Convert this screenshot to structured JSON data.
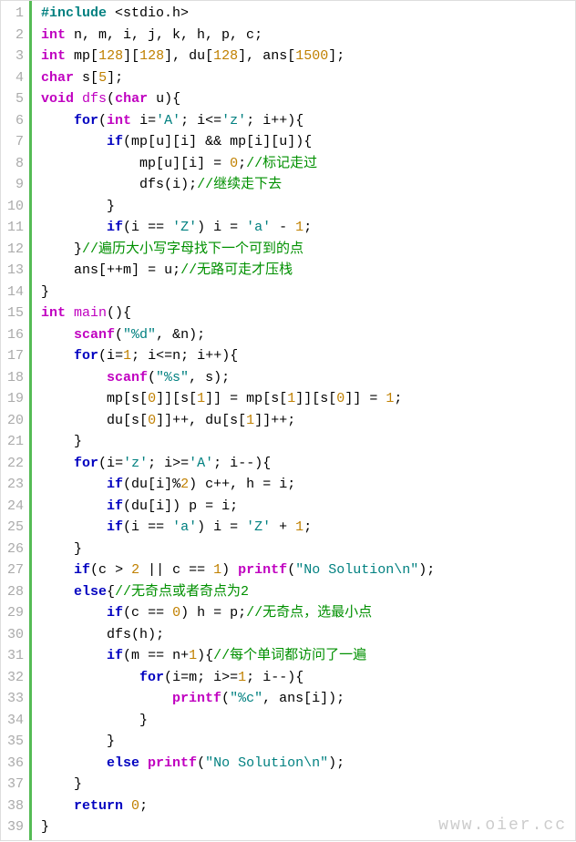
{
  "watermark": "www.oier.cc",
  "line_count": 39,
  "code_lines": [
    [
      [
        "pp",
        "#include"
      ],
      [
        "op",
        " <"
      ],
      [
        "id",
        "stdio.h"
      ],
      [
        "op",
        ">"
      ]
    ],
    [
      [
        "ty",
        "int"
      ],
      [
        "op",
        " "
      ],
      [
        "id",
        "n, m, i, j, k, h, p, c"
      ],
      [
        "op",
        ";"
      ]
    ],
    [
      [
        "ty",
        "int"
      ],
      [
        "op",
        " "
      ],
      [
        "id",
        "mp"
      ],
      [
        "op",
        "["
      ],
      [
        "num",
        "128"
      ],
      [
        "op",
        "]["
      ],
      [
        "num",
        "128"
      ],
      [
        "op",
        "], "
      ],
      [
        "id",
        "du"
      ],
      [
        "op",
        "["
      ],
      [
        "num",
        "128"
      ],
      [
        "op",
        "], "
      ],
      [
        "id",
        "ans"
      ],
      [
        "op",
        "["
      ],
      [
        "num",
        "1500"
      ],
      [
        "op",
        "];"
      ]
    ],
    [
      [
        "ty",
        "char"
      ],
      [
        "op",
        " "
      ],
      [
        "id",
        "s"
      ],
      [
        "op",
        "["
      ],
      [
        "num",
        "5"
      ],
      [
        "op",
        "];"
      ]
    ],
    [
      [
        "ty",
        "void"
      ],
      [
        "op",
        " "
      ],
      [
        "fn",
        "dfs"
      ],
      [
        "op",
        "("
      ],
      [
        "ty",
        "char"
      ],
      [
        "op",
        " "
      ],
      [
        "id",
        "u"
      ],
      [
        "op",
        "){"
      ]
    ],
    [
      [
        "op",
        "    "
      ],
      [
        "kw",
        "for"
      ],
      [
        "op",
        "("
      ],
      [
        "ty",
        "int"
      ],
      [
        "op",
        " "
      ],
      [
        "id",
        "i"
      ],
      [
        "op",
        "="
      ],
      [
        "chr",
        "'A'"
      ],
      [
        "op",
        "; "
      ],
      [
        "id",
        "i"
      ],
      [
        "op",
        "<="
      ],
      [
        "chr",
        "'z'"
      ],
      [
        "op",
        "; "
      ],
      [
        "id",
        "i"
      ],
      [
        "op",
        "++){"
      ]
    ],
    [
      [
        "op",
        "        "
      ],
      [
        "kw",
        "if"
      ],
      [
        "op",
        "("
      ],
      [
        "id",
        "mp"
      ],
      [
        "op",
        "["
      ],
      [
        "id",
        "u"
      ],
      [
        "op",
        "]["
      ],
      [
        "id",
        "i"
      ],
      [
        "op",
        "] && "
      ],
      [
        "id",
        "mp"
      ],
      [
        "op",
        "["
      ],
      [
        "id",
        "i"
      ],
      [
        "op",
        "]["
      ],
      [
        "id",
        "u"
      ],
      [
        "op",
        "]){"
      ]
    ],
    [
      [
        "op",
        "            "
      ],
      [
        "id",
        "mp"
      ],
      [
        "op",
        "["
      ],
      [
        "id",
        "u"
      ],
      [
        "op",
        "]["
      ],
      [
        "id",
        "i"
      ],
      [
        "op",
        "] = "
      ],
      [
        "num",
        "0"
      ],
      [
        "op",
        ";"
      ],
      [
        "cmt",
        "//标记走过"
      ]
    ],
    [
      [
        "op",
        "            "
      ],
      [
        "id",
        "dfs"
      ],
      [
        "op",
        "("
      ],
      [
        "id",
        "i"
      ],
      [
        "op",
        ");"
      ],
      [
        "cmt",
        "//继续走下去"
      ]
    ],
    [
      [
        "op",
        "        }"
      ]
    ],
    [
      [
        "op",
        "        "
      ],
      [
        "kw",
        "if"
      ],
      [
        "op",
        "("
      ],
      [
        "id",
        "i"
      ],
      [
        "op",
        " == "
      ],
      [
        "chr",
        "'Z'"
      ],
      [
        "op",
        ") "
      ],
      [
        "id",
        "i"
      ],
      [
        "op",
        " = "
      ],
      [
        "chr",
        "'a'"
      ],
      [
        "op",
        " - "
      ],
      [
        "num",
        "1"
      ],
      [
        "op",
        ";"
      ]
    ],
    [
      [
        "op",
        "    }"
      ],
      [
        "cmt",
        "//遍历大小写字母找下一个可到的点"
      ]
    ],
    [
      [
        "op",
        "    "
      ],
      [
        "id",
        "ans"
      ],
      [
        "op",
        "[++"
      ],
      [
        "id",
        "m"
      ],
      [
        "op",
        "] = "
      ],
      [
        "id",
        "u"
      ],
      [
        "op",
        ";"
      ],
      [
        "cmt",
        "//无路可走才压栈"
      ]
    ],
    [
      [
        "op",
        "}"
      ]
    ],
    [
      [
        "ty",
        "int"
      ],
      [
        "op",
        " "
      ],
      [
        "fn",
        "main"
      ],
      [
        "op",
        "(){"
      ]
    ],
    [
      [
        "op",
        "    "
      ],
      [
        "lib",
        "scanf"
      ],
      [
        "op",
        "("
      ],
      [
        "str",
        "\"%d\""
      ],
      [
        "op",
        ", &"
      ],
      [
        "id",
        "n"
      ],
      [
        "op",
        ");"
      ]
    ],
    [
      [
        "op",
        "    "
      ],
      [
        "kw",
        "for"
      ],
      [
        "op",
        "("
      ],
      [
        "id",
        "i"
      ],
      [
        "op",
        "="
      ],
      [
        "num",
        "1"
      ],
      [
        "op",
        "; "
      ],
      [
        "id",
        "i"
      ],
      [
        "op",
        "<="
      ],
      [
        "id",
        "n"
      ],
      [
        "op",
        "; "
      ],
      [
        "id",
        "i"
      ],
      [
        "op",
        "++){"
      ]
    ],
    [
      [
        "op",
        "        "
      ],
      [
        "lib",
        "scanf"
      ],
      [
        "op",
        "("
      ],
      [
        "str",
        "\"%s\""
      ],
      [
        "op",
        ", "
      ],
      [
        "id",
        "s"
      ],
      [
        "op",
        ");"
      ]
    ],
    [
      [
        "op",
        "        "
      ],
      [
        "id",
        "mp"
      ],
      [
        "op",
        "["
      ],
      [
        "id",
        "s"
      ],
      [
        "op",
        "["
      ],
      [
        "num",
        "0"
      ],
      [
        "op",
        "]]["
      ],
      [
        "id",
        "s"
      ],
      [
        "op",
        "["
      ],
      [
        "num",
        "1"
      ],
      [
        "op",
        "]] = "
      ],
      [
        "id",
        "mp"
      ],
      [
        "op",
        "["
      ],
      [
        "id",
        "s"
      ],
      [
        "op",
        "["
      ],
      [
        "num",
        "1"
      ],
      [
        "op",
        "]]["
      ],
      [
        "id",
        "s"
      ],
      [
        "op",
        "["
      ],
      [
        "num",
        "0"
      ],
      [
        "op",
        "]] = "
      ],
      [
        "num",
        "1"
      ],
      [
        "op",
        ";"
      ]
    ],
    [
      [
        "op",
        "        "
      ],
      [
        "id",
        "du"
      ],
      [
        "op",
        "["
      ],
      [
        "id",
        "s"
      ],
      [
        "op",
        "["
      ],
      [
        "num",
        "0"
      ],
      [
        "op",
        "]]++, "
      ],
      [
        "id",
        "du"
      ],
      [
        "op",
        "["
      ],
      [
        "id",
        "s"
      ],
      [
        "op",
        "["
      ],
      [
        "num",
        "1"
      ],
      [
        "op",
        "]]++;"
      ]
    ],
    [
      [
        "op",
        "    }"
      ]
    ],
    [
      [
        "op",
        "    "
      ],
      [
        "kw",
        "for"
      ],
      [
        "op",
        "("
      ],
      [
        "id",
        "i"
      ],
      [
        "op",
        "="
      ],
      [
        "chr",
        "'z'"
      ],
      [
        "op",
        "; "
      ],
      [
        "id",
        "i"
      ],
      [
        "op",
        ">="
      ],
      [
        "chr",
        "'A'"
      ],
      [
        "op",
        "; "
      ],
      [
        "id",
        "i"
      ],
      [
        "op",
        "--){"
      ]
    ],
    [
      [
        "op",
        "        "
      ],
      [
        "kw",
        "if"
      ],
      [
        "op",
        "("
      ],
      [
        "id",
        "du"
      ],
      [
        "op",
        "["
      ],
      [
        "id",
        "i"
      ],
      [
        "op",
        "]%"
      ],
      [
        "num",
        "2"
      ],
      [
        "op",
        ") "
      ],
      [
        "id",
        "c"
      ],
      [
        "op",
        "++, "
      ],
      [
        "id",
        "h"
      ],
      [
        "op",
        " = "
      ],
      [
        "id",
        "i"
      ],
      [
        "op",
        ";"
      ]
    ],
    [
      [
        "op",
        "        "
      ],
      [
        "kw",
        "if"
      ],
      [
        "op",
        "("
      ],
      [
        "id",
        "du"
      ],
      [
        "op",
        "["
      ],
      [
        "id",
        "i"
      ],
      [
        "op",
        "]) "
      ],
      [
        "id",
        "p"
      ],
      [
        "op",
        " = "
      ],
      [
        "id",
        "i"
      ],
      [
        "op",
        ";"
      ]
    ],
    [
      [
        "op",
        "        "
      ],
      [
        "kw",
        "if"
      ],
      [
        "op",
        "("
      ],
      [
        "id",
        "i"
      ],
      [
        "op",
        " == "
      ],
      [
        "chr",
        "'a'"
      ],
      [
        "op",
        ") "
      ],
      [
        "id",
        "i"
      ],
      [
        "op",
        " = "
      ],
      [
        "chr",
        "'Z'"
      ],
      [
        "op",
        " + "
      ],
      [
        "num",
        "1"
      ],
      [
        "op",
        ";"
      ]
    ],
    [
      [
        "op",
        "    }"
      ]
    ],
    [
      [
        "op",
        "    "
      ],
      [
        "kw",
        "if"
      ],
      [
        "op",
        "("
      ],
      [
        "id",
        "c"
      ],
      [
        "op",
        " > "
      ],
      [
        "num",
        "2"
      ],
      [
        "op",
        " || "
      ],
      [
        "id",
        "c"
      ],
      [
        "op",
        " == "
      ],
      [
        "num",
        "1"
      ],
      [
        "op",
        ") "
      ],
      [
        "lib",
        "printf"
      ],
      [
        "op",
        "("
      ],
      [
        "str",
        "\"No Solution\\n\""
      ],
      [
        "op",
        ");"
      ]
    ],
    [
      [
        "op",
        "    "
      ],
      [
        "kw",
        "else"
      ],
      [
        "op",
        "{"
      ],
      [
        "cmt",
        "//无奇点或者奇点为2"
      ]
    ],
    [
      [
        "op",
        "        "
      ],
      [
        "kw",
        "if"
      ],
      [
        "op",
        "("
      ],
      [
        "id",
        "c"
      ],
      [
        "op",
        " == "
      ],
      [
        "num",
        "0"
      ],
      [
        "op",
        ") "
      ],
      [
        "id",
        "h"
      ],
      [
        "op",
        " = "
      ],
      [
        "id",
        "p"
      ],
      [
        "op",
        ";"
      ],
      [
        "cmt",
        "//无奇点，选最小点"
      ]
    ],
    [
      [
        "op",
        "        "
      ],
      [
        "id",
        "dfs"
      ],
      [
        "op",
        "("
      ],
      [
        "id",
        "h"
      ],
      [
        "op",
        ");"
      ]
    ],
    [
      [
        "op",
        "        "
      ],
      [
        "kw",
        "if"
      ],
      [
        "op",
        "("
      ],
      [
        "id",
        "m"
      ],
      [
        "op",
        " == "
      ],
      [
        "id",
        "n"
      ],
      [
        "op",
        "+"
      ],
      [
        "num",
        "1"
      ],
      [
        "op",
        "){"
      ],
      [
        "cmt",
        "//每个单词都访问了一遍"
      ]
    ],
    [
      [
        "op",
        "            "
      ],
      [
        "kw",
        "for"
      ],
      [
        "op",
        "("
      ],
      [
        "id",
        "i"
      ],
      [
        "op",
        "="
      ],
      [
        "id",
        "m"
      ],
      [
        "op",
        "; "
      ],
      [
        "id",
        "i"
      ],
      [
        "op",
        ">="
      ],
      [
        "num",
        "1"
      ],
      [
        "op",
        "; "
      ],
      [
        "id",
        "i"
      ],
      [
        "op",
        "--){"
      ]
    ],
    [
      [
        "op",
        "                "
      ],
      [
        "lib",
        "printf"
      ],
      [
        "op",
        "("
      ],
      [
        "str",
        "\"%c\""
      ],
      [
        "op",
        ", "
      ],
      [
        "id",
        "ans"
      ],
      [
        "op",
        "["
      ],
      [
        "id",
        "i"
      ],
      [
        "op",
        "]);"
      ]
    ],
    [
      [
        "op",
        "            }"
      ]
    ],
    [
      [
        "op",
        "        }"
      ]
    ],
    [
      [
        "op",
        "        "
      ],
      [
        "kw",
        "else"
      ],
      [
        "op",
        " "
      ],
      [
        "lib",
        "printf"
      ],
      [
        "op",
        "("
      ],
      [
        "str",
        "\"No Solution\\n\""
      ],
      [
        "op",
        ");"
      ]
    ],
    [
      [
        "op",
        "    }"
      ]
    ],
    [
      [
        "op",
        "    "
      ],
      [
        "kw",
        "return"
      ],
      [
        "op",
        " "
      ],
      [
        "num",
        "0"
      ],
      [
        "op",
        ";"
      ]
    ],
    [
      [
        "op",
        "}"
      ]
    ]
  ]
}
